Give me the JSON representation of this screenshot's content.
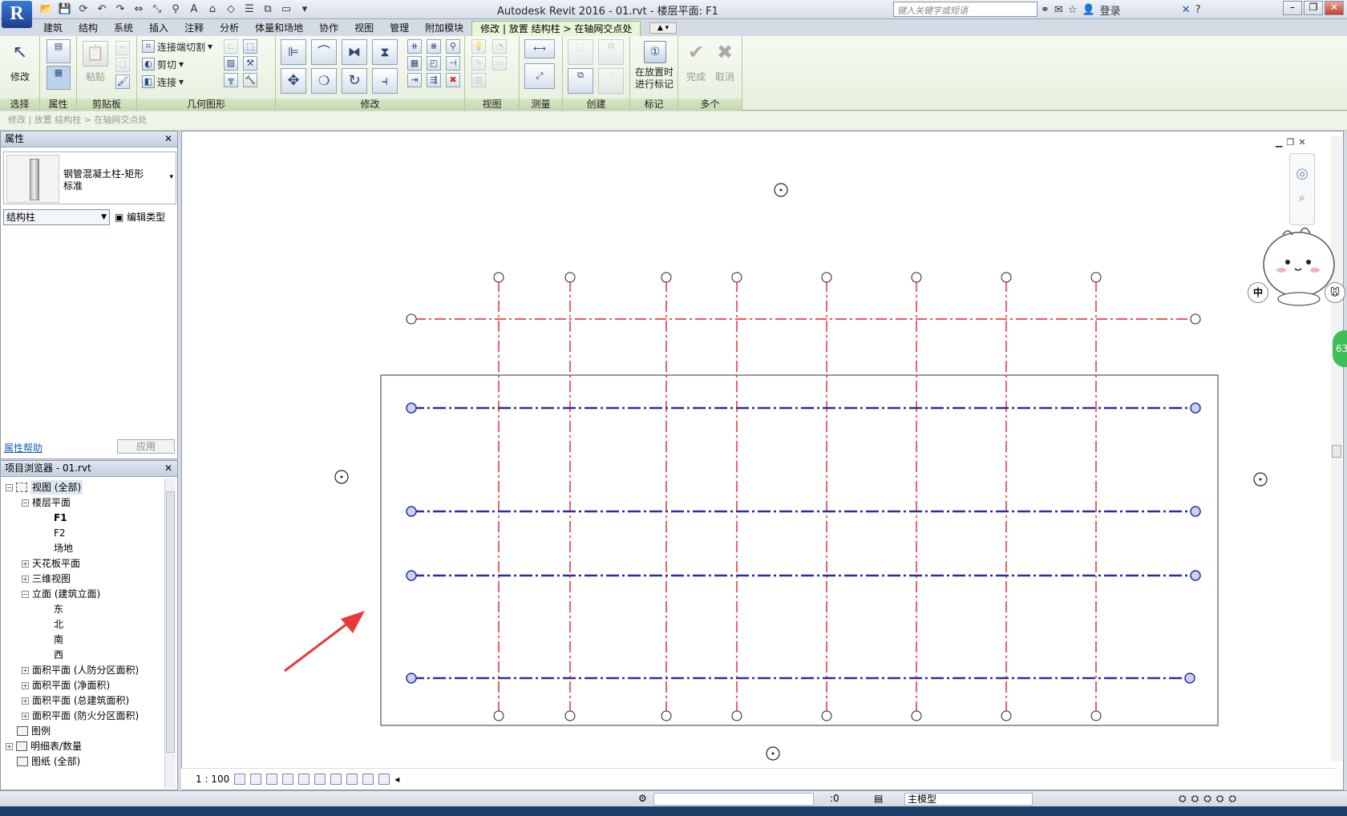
{
  "window": {
    "title": "Autodesk Revit 2016 -     01.rvt - 楼层平面: F1",
    "search_placeholder": "键入关键字或短语",
    "login_label": "登录",
    "logo": "R"
  },
  "tabs": [
    "建筑",
    "结构",
    "系统",
    "插入",
    "注释",
    "分析",
    "体量和场地",
    "协作",
    "视图",
    "管理",
    "附加模块",
    "修改 | 放置 结构柱 > 在轴网交点处"
  ],
  "ribbon": {
    "select": {
      "modify_label": "修改",
      "panel": "选择"
    },
    "properties": {
      "panel": "属性"
    },
    "clipboard": {
      "paste_label": "粘贴",
      "panel": "剪贴板"
    },
    "geometry": {
      "join_cut": "连接端切割",
      "cut": "剪切",
      "join": "连接",
      "panel": "几何图形"
    },
    "modify": {
      "panel": "修改"
    },
    "view": {
      "panel": "视图"
    },
    "measure": {
      "panel": "测量"
    },
    "create": {
      "panel": "创建"
    },
    "tag": {
      "tag_label": "在放置时进行标记",
      "panel": "标记"
    },
    "multiple": {
      "finish": "完成",
      "cancel": "取消",
      "panel": "多个"
    }
  },
  "context_bar": "修改 | 放置 结构柱 > 在轴网交点处",
  "properties": {
    "title": "属性",
    "type_name_line1": "钢管混凝土柱-矩形",
    "type_name_line2": "标准",
    "category": "结构柱",
    "edit_type": "编辑类型",
    "help_link": "属性帮助",
    "apply": "应用"
  },
  "browser": {
    "title": "项目浏览器 - 01.rvt",
    "items": [
      {
        "label": "视图 (全部)"
      },
      {
        "label": "楼层平面"
      },
      {
        "label": "F1"
      },
      {
        "label": "F2"
      },
      {
        "label": "场地"
      },
      {
        "label": "天花板平面"
      },
      {
        "label": "三维视图"
      },
      {
        "label": "立面 (建筑立面)"
      },
      {
        "label": "东"
      },
      {
        "label": "北"
      },
      {
        "label": "南"
      },
      {
        "label": "西"
      },
      {
        "label": "面积平面 (人防分区面积)"
      },
      {
        "label": "面积平面 (净面积)"
      },
      {
        "label": "面积平面 (总建筑面积)"
      },
      {
        "label": "面积平面 (防火分区面积)"
      },
      {
        "label": "图例"
      },
      {
        "label": "明细表/数量"
      },
      {
        "label": "图纸 (全部)"
      }
    ]
  },
  "view": {
    "scale": "1 : 100"
  },
  "status": {
    "zero": ":0",
    "model": "主模型"
  },
  "overlay": {
    "ime_cn": "中",
    "badge": "63"
  },
  "colors": {
    "grid_red": "#e8202a",
    "grid_blue": "#2e2e9a",
    "ribbon_green": "#e9f5d8",
    "arrow": "#e8383a"
  }
}
